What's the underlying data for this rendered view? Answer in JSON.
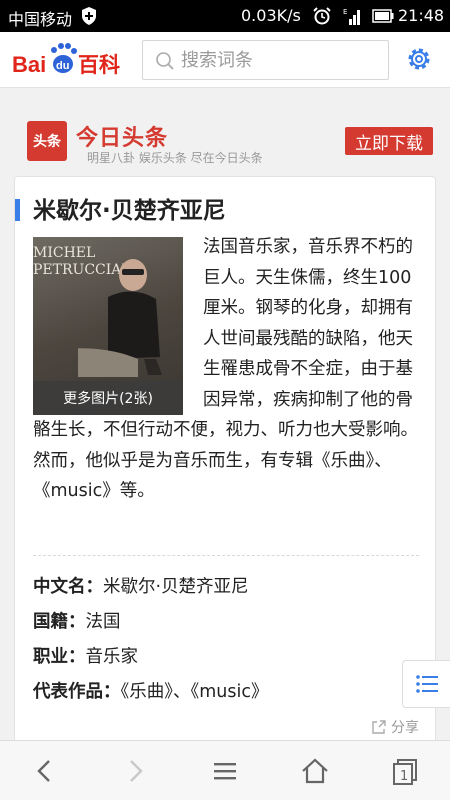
{
  "status_bar": {
    "carrier": "中国移动",
    "network_speed": "0.03K/s",
    "time": "21:48"
  },
  "header": {
    "logo_text": "Baidu百科",
    "search": {
      "placeholder": "搜索词条"
    },
    "icons": {
      "search": "search-icon",
      "settings": "gear-icon"
    }
  },
  "ad": {
    "logo_text": "头条",
    "title": "今日头条",
    "subtitle": "明星八卦 娱乐头条 尽在今日头条",
    "button_label": "立即下载"
  },
  "article": {
    "title": "米歇尔·贝楚齐亚尼",
    "image_caption": "更多图片(2张)",
    "image_text": "MICHEL PETRUCCIANI",
    "description": "法国音乐家，音乐界不朽的巨人。天生侏儒，终生100厘米。钢琴的化身，却拥有人世间最残酷的缺陷，他天生罹患成骨不全症，由于基因异常，疾病抑制了他的骨骼生长，不但行动不便，视力、听力也大受影响。然而，他似乎是为音乐而生，有专辑《乐曲》、《music》等。",
    "info": [
      {
        "key": "中文名：",
        "value": "米歇尔·贝楚齐亚尼"
      },
      {
        "key": "国籍：",
        "value": "法国"
      },
      {
        "key": "职业：",
        "value": "音乐家"
      },
      {
        "key": "代表作品：",
        "value": "《乐曲》、《music》"
      }
    ],
    "share_label": "分享"
  },
  "colors": {
    "brand_red": "#d43a30",
    "accent_blue": "#3a7ee8",
    "baidu_blue": "#2e63d8"
  },
  "bottom_nav": {
    "icons": [
      "back-icon",
      "forward-icon",
      "menu-icon",
      "home-icon",
      "tabs-icon"
    ],
    "tab_count": "1"
  }
}
